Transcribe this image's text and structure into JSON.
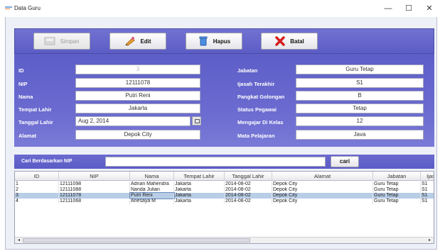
{
  "window": {
    "title": "Data Guru",
    "minimize_glyph": "—",
    "maximize_glyph": "☐",
    "close_glyph": "✕"
  },
  "toolbar": {
    "save_label": "Simpan",
    "edit_label": "Edit",
    "delete_label": "Hapus",
    "cancel_label": "Batal"
  },
  "form": {
    "id_label": "ID",
    "id_value": "3",
    "nip_label": "NIP",
    "nip_value": "12111078",
    "nama_label": "Nama",
    "nama_value": "Putri Reni",
    "tempat_lahir_label": "Tempat Lahir",
    "tempat_lahir_value": "Jakarta",
    "tanggal_lahir_label": "Tanggal Lahir",
    "tanggal_lahir_value": "Aug 2, 2014",
    "alamat_label": "Alamat",
    "alamat_value": "Depok City",
    "jabatan_label": "Jabatan",
    "jabatan_value": "Guru Tetap",
    "ijasah_label": "Ijasah Terakhir",
    "ijasah_value": "S1",
    "pangkat_label": "Pangkat Golongan",
    "pangkat_value": "B",
    "status_label": "Status Pegawai",
    "status_value": "Tetap",
    "kelas_label": "Mengajar Di Kelas",
    "kelas_value": "12",
    "mapel_label": "Mata Pelajaran",
    "mapel_value": "Java"
  },
  "search": {
    "label": "Cari Berdasarkan NIP",
    "value": "",
    "button_label": "cari"
  },
  "table": {
    "headers": [
      "ID",
      "NIP",
      "Nama",
      "Tempat Lahir",
      "Tanggal Lahir",
      "Alamat",
      "Jabatan",
      "Ijas"
    ],
    "rows": [
      [
        "1",
        "12111098",
        "Adnan Mahendra",
        "Jakarta",
        "2014-08-02",
        "Depok City",
        "Guru Tetap",
        "S1"
      ],
      [
        "2",
        "12111088",
        "Nanda Julian",
        "Jakarta",
        "2014-08-02",
        "Depok City",
        "Guru Tetap",
        "S1"
      ],
      [
        "3",
        "12111078",
        "Putri Reni",
        "Jakarta",
        "2014-08-02",
        "Depok City",
        "Guru Tetap",
        "S1"
      ],
      [
        "4",
        "12111068",
        "Anesaya M",
        "Jakarta",
        "2014-08-02",
        "Depok City",
        "Guru Tetap",
        "S1"
      ]
    ],
    "selected_row": 2,
    "scroll_left_glyph": "◂",
    "scroll_right_glyph": "▸"
  },
  "colors": {
    "panel_blue": "#6464cc",
    "selection": "#b8cde6"
  }
}
